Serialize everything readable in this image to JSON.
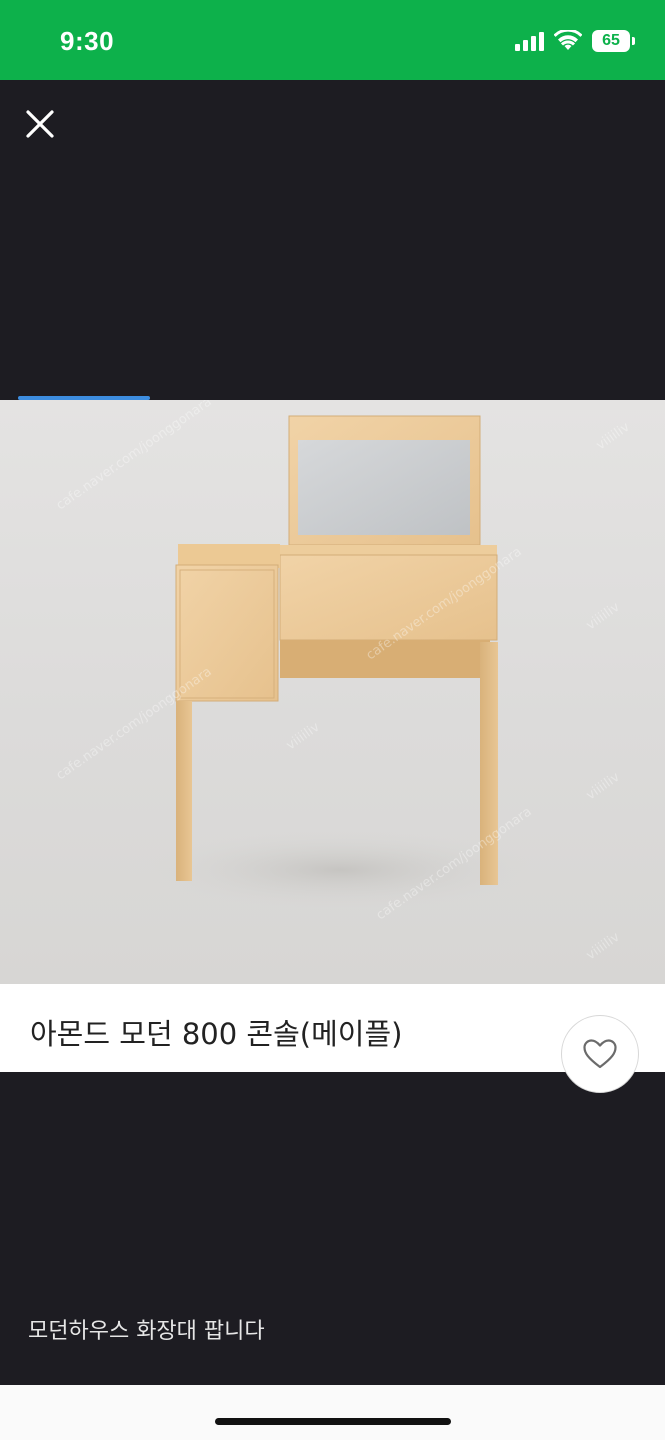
{
  "status_bar": {
    "time": "9:30",
    "battery_level": "65",
    "icons": [
      "signal-icon",
      "wifi-icon",
      "battery-icon"
    ]
  },
  "viewer": {
    "close_icon": "close-icon",
    "image_index_indicator": "progress-indicator"
  },
  "product": {
    "title": "아몬드 모던 800 콘솔(메이플)",
    "like_icon": "heart-icon",
    "description": "모던하우스 화장대 팝니다"
  },
  "colors": {
    "status_bar_bg": "#0db14b",
    "page_bg": "#1d1c22",
    "indicator": "#3d8de0"
  }
}
